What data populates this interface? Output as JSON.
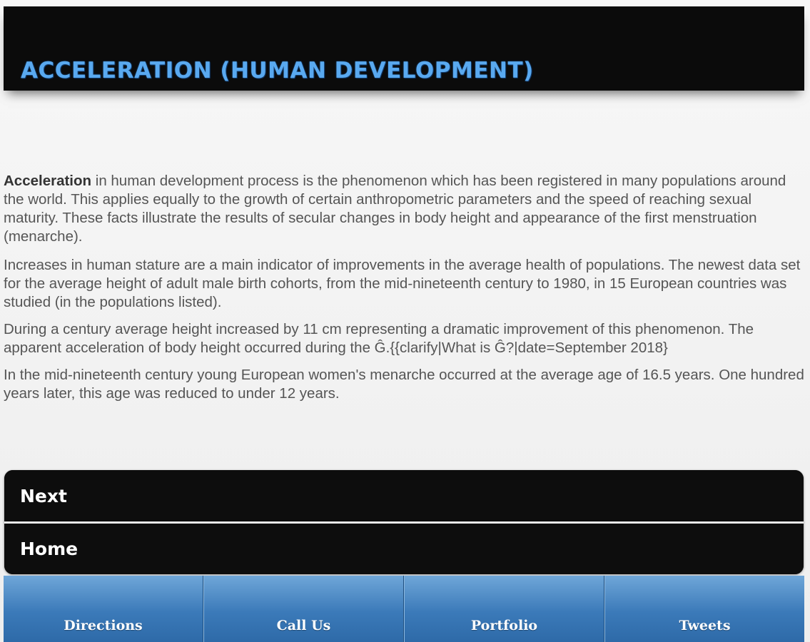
{
  "header": {
    "title": "ACCELERATION (HUMAN DEVELOPMENT)"
  },
  "article": {
    "p1_bold": "Acceleration",
    "p1_rest": " in human development process is the phenomenon which has been registered in many populations around the world. This applies equally to the growth of certain anthropometric parameters and the speed of reaching sexual maturity. These facts illustrate the results of secular changes in body height and appearance of the first menstruation (menarche).",
    "p2": "Increases in human stature are a main indicator of improvements in the average health of populations. The newest data set for the average height of adult male birth cohorts, from the mid-nineteenth century to 1980, in 15 European countries was studied (in the populations listed).",
    "p3": "During a century average height increased by 11 cm representing a dramatic improvement of this phenomenon. The apparent acceleration of body height occurred during the Ĝ.{{clarify|What is Ĝ?|date=September 2018}",
    "p4": "In the mid-nineteenth century young European women's menarche occurred at the average age of 16.5 years. One hundred years later, this age was reduced to under 12 years."
  },
  "nav": {
    "next_label": "Next",
    "home_label": "Home"
  },
  "footer": {
    "directions_label": "Directions",
    "call_label": "Call Us",
    "portfolio_label": "Portfolio",
    "tweets_label": "Tweets"
  },
  "colors": {
    "header_bg": "#0b0b0b",
    "title_color": "#59a9f0",
    "footer_blue": "#3b7ab9"
  }
}
